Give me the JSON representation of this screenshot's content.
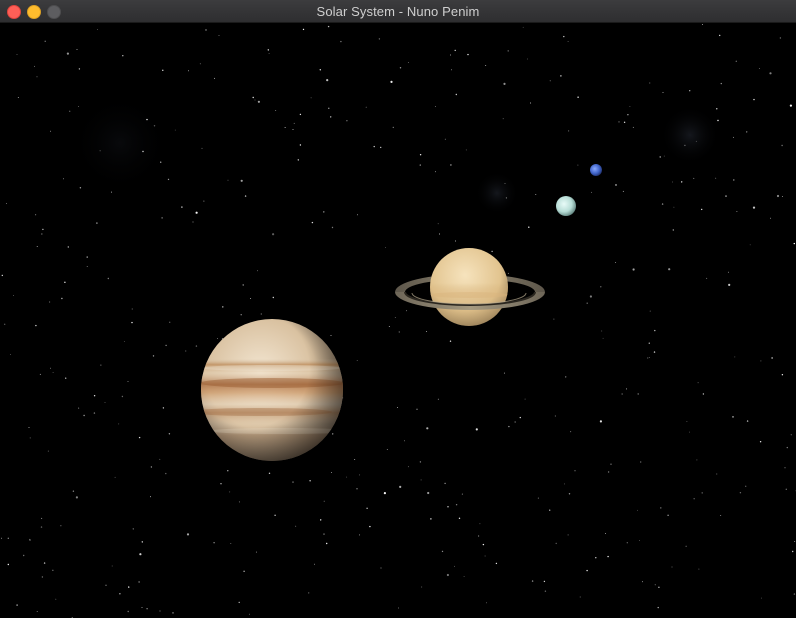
{
  "window": {
    "title": "Solar System - Nuno Penim"
  },
  "traffic_lights": {
    "close_color": "#fe5f57",
    "minimize_color": "#febc2e",
    "zoom_color": "#5d5d60"
  },
  "scene": {
    "background_color": "#000000",
    "bodies": [
      "jupiter",
      "saturn",
      "uranus",
      "neptune"
    ]
  }
}
